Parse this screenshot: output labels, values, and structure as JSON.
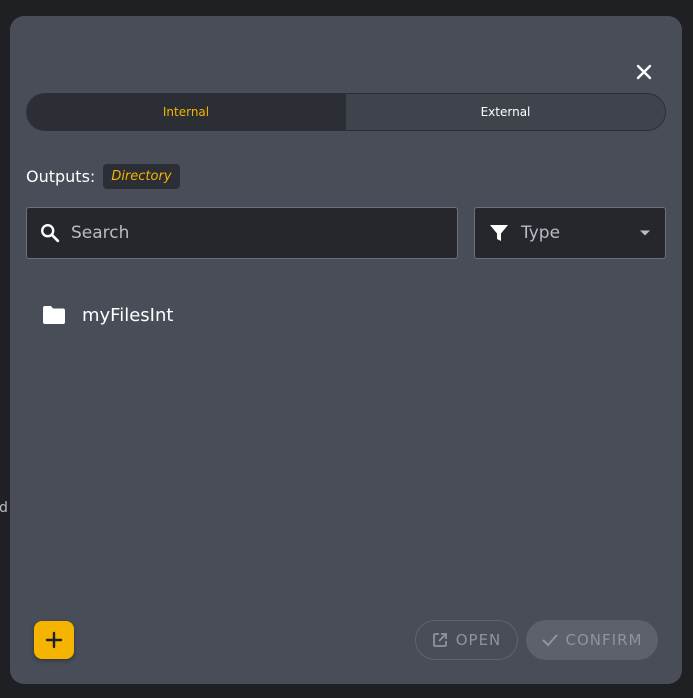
{
  "background": {
    "fragment_text": "d"
  },
  "dialog": {
    "tabs": [
      {
        "label": "Internal",
        "active": true
      },
      {
        "label": "External",
        "active": false
      }
    ],
    "outputs_label": "Outputs:",
    "outputs_badge": "Directory",
    "search": {
      "placeholder": "Search",
      "value": ""
    },
    "type_filter": {
      "label": "Type"
    },
    "files": [
      {
        "name": "myFilesInt",
        "icon": "folder-icon"
      }
    ],
    "actions": {
      "open_label": "OPEN",
      "confirm_label": "CONFIRM"
    }
  },
  "colors": {
    "accent": "#f5b400",
    "dialog_bg": "#484d58",
    "page_bg": "#1f2024"
  }
}
